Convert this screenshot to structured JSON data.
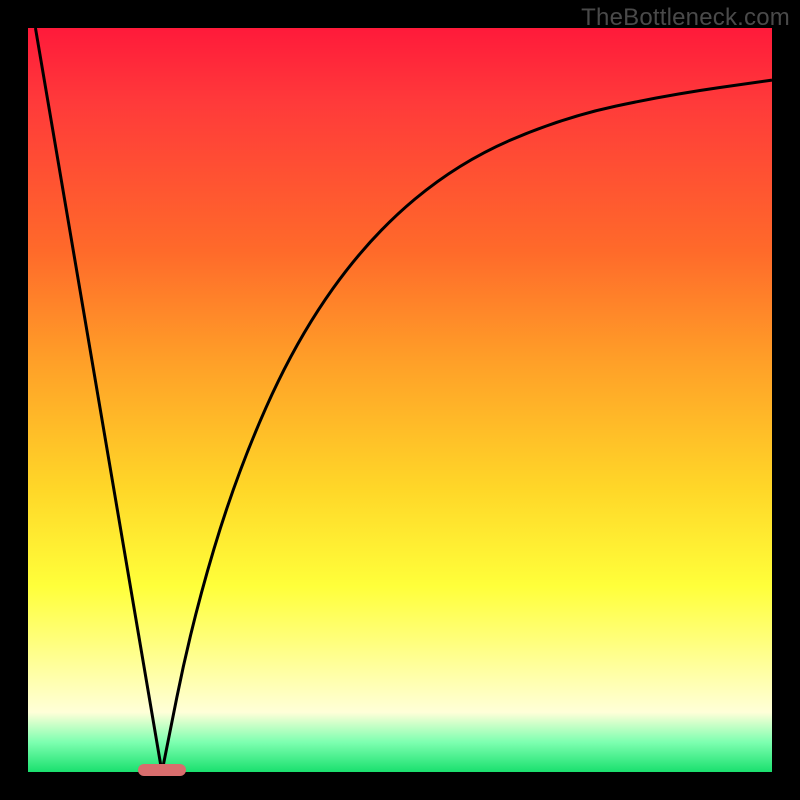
{
  "watermark": "TheBottleneck.com",
  "chart_data": {
    "type": "line",
    "title": "",
    "xlabel": "",
    "ylabel": "",
    "xlim": [
      0,
      100
    ],
    "ylim": [
      0,
      100
    ],
    "note": "Axes are unlabeled in the image; values below are relative percentages (0=left/bottom, 100=right/top) estimated from pixel positions.",
    "series": [
      {
        "name": "left-descending-line",
        "x": [
          1,
          18
        ],
        "y": [
          100,
          0
        ]
      },
      {
        "name": "right-rising-curve",
        "x": [
          18,
          22,
          28,
          36,
          46,
          58,
          72,
          86,
          100
        ],
        "y": [
          0,
          20,
          40,
          58,
          72,
          82,
          88,
          91,
          93
        ]
      }
    ],
    "optimum_marker_x": 18,
    "background_gradient": {
      "top": "#ff1a3a",
      "mid": "#ffd728",
      "bottom": "#1ae06e"
    }
  }
}
